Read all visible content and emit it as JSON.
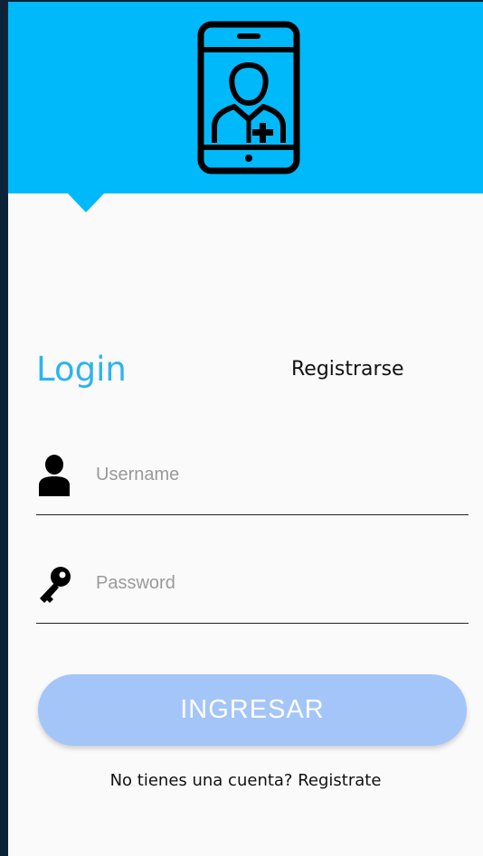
{
  "icons": {
    "logo": "smartphone-doctor-icon",
    "username": "user-icon",
    "password": "key-icon"
  },
  "colors": {
    "header": "#00b9fb",
    "accent_tab": "#2cb4ee",
    "button": "#a4c5f8",
    "side_bar": "#0d2438"
  },
  "tabs": {
    "login": "Login",
    "register": "Registrarse"
  },
  "form": {
    "username_placeholder": "Username",
    "username_value": "",
    "password_placeholder": "Password",
    "password_value": "",
    "submit_label": "INGRESAR"
  },
  "footer": {
    "signup_prompt": "No tienes una cuenta? Registrate"
  }
}
